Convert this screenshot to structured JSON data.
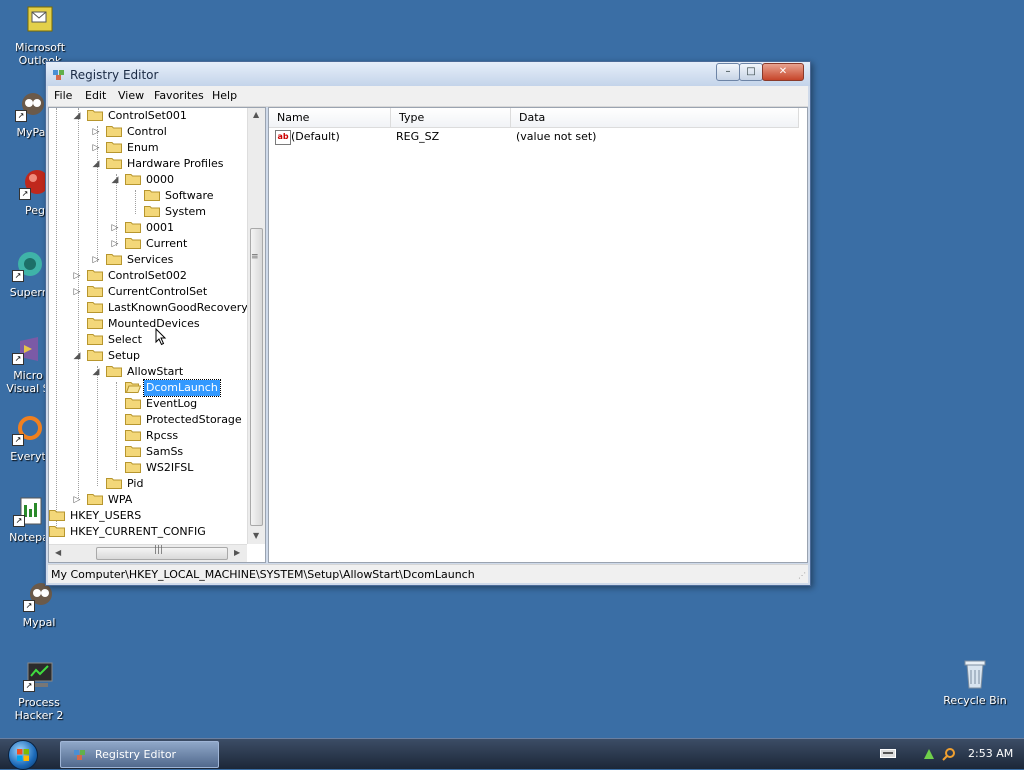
{
  "desktop": {
    "icons": [
      {
        "label": "Microsoft\nOutlook"
      },
      {
        "label": "MyPa"
      },
      {
        "label": "Peg"
      },
      {
        "label": "Superr"
      },
      {
        "label": "Micro\nVisual S"
      },
      {
        "label": "Everyt"
      },
      {
        "label": "Notepa"
      },
      {
        "label": "Mypal"
      },
      {
        "label": "Process\nHacker 2"
      },
      {
        "label": "Recycle Bin"
      }
    ]
  },
  "window": {
    "title": "Registry Editor",
    "controls": {
      "minimize": "–",
      "maximize": "□",
      "close": "✕"
    },
    "menu": [
      "File",
      "Edit",
      "View",
      "Favorites",
      "Help"
    ],
    "tree": [
      {
        "label": "ControlSet001",
        "expander": "◢"
      },
      {
        "label": "Control",
        "expander": "▷"
      },
      {
        "label": "Enum",
        "expander": "▷"
      },
      {
        "label": "Hardware Profiles",
        "expander": "◢"
      },
      {
        "label": "0000",
        "expander": "◢"
      },
      {
        "label": "Software",
        "expander": ""
      },
      {
        "label": "System",
        "expander": ""
      },
      {
        "label": "0001",
        "expander": "▷"
      },
      {
        "label": "Current",
        "expander": "▷"
      },
      {
        "label": "Services",
        "expander": "▷"
      },
      {
        "label": "ControlSet002",
        "expander": "▷"
      },
      {
        "label": "CurrentControlSet",
        "expander": "▷"
      },
      {
        "label": "LastKnownGoodRecovery",
        "expander": ""
      },
      {
        "label": "MountedDevices",
        "expander": ""
      },
      {
        "label": "Select",
        "expander": ""
      },
      {
        "label": "Setup",
        "expander": "◢"
      },
      {
        "label": "AllowStart",
        "expander": "◢"
      },
      {
        "label": "DcomLaunch",
        "expander": ""
      },
      {
        "label": "EventLog",
        "expander": ""
      },
      {
        "label": "ProtectedStorage",
        "expander": ""
      },
      {
        "label": "Rpcss",
        "expander": ""
      },
      {
        "label": "SamSs",
        "expander": ""
      },
      {
        "label": "WS2IFSL",
        "expander": ""
      },
      {
        "label": "Pid",
        "expander": ""
      },
      {
        "label": "WPA",
        "expander": "▷"
      },
      {
        "label": "HKEY_USERS",
        "expander": "▷"
      },
      {
        "label": "HKEY_CURRENT_CONFIG",
        "expander": "▷"
      }
    ],
    "selected_key": "DcomLaunch",
    "columns": {
      "name": "Name",
      "type": "Type",
      "data": "Data"
    },
    "values": [
      {
        "name": "(Default)",
        "type": "REG_SZ",
        "data": "(value not set)",
        "icon": "ab"
      }
    ],
    "status_path": "My Computer\\HKEY_LOCAL_MACHINE\\SYSTEM\\Setup\\AllowStart\\DcomLaunch"
  },
  "taskbar": {
    "task_label": "Registry Editor",
    "clock": "2:53 AM"
  }
}
